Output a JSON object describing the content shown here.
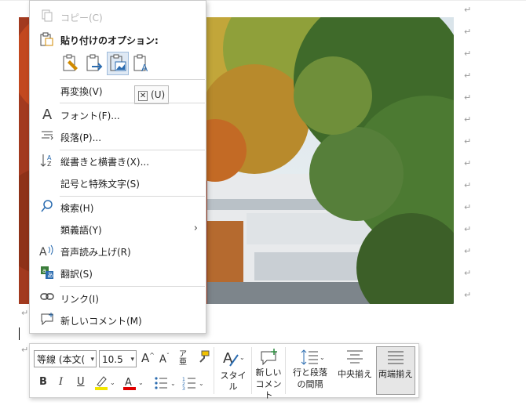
{
  "context_menu": {
    "copy": "コピー(C)",
    "paste_header": "貼り付けのオプション:",
    "paste_options": [
      {
        "icon": "paste-keep-source-icon"
      },
      {
        "icon": "paste-merge-format-icon"
      },
      {
        "icon": "paste-picture-icon"
      },
      {
        "icon": "paste-text-only-icon"
      }
    ],
    "tooltip": "(U)",
    "items": [
      {
        "label": "再変換(V)",
        "icon": ""
      },
      {
        "label": "フォント(F)...",
        "icon": "font-icon"
      },
      {
        "label": "段落(P)...",
        "icon": "paragraph-icon"
      },
      {
        "label": "縦書きと横書き(X)...",
        "icon": "text-direction-icon"
      },
      {
        "label": "記号と特殊文字(S)",
        "icon": ""
      },
      {
        "label": "検索(H)",
        "icon": "search-icon"
      },
      {
        "label": "類義語(Y)",
        "icon": ""
      },
      {
        "label": "音声読み上げ(R)",
        "icon": "read-aloud-icon"
      },
      {
        "label": "翻訳(S)",
        "icon": "translate-icon"
      },
      {
        "label": "リンク(I)",
        "icon": "link-icon"
      },
      {
        "label": "新しいコメント(M)",
        "icon": "new-comment-icon"
      }
    ]
  },
  "mini_toolbar": {
    "font_name": "等線 (本文(",
    "font_size": "10.5",
    "bold": "B",
    "italic": "I",
    "underline": "U",
    "style_label": "スタイル",
    "new_comment_label_1": "新しい",
    "new_comment_label_2": "コメント",
    "line_spacing_label_1": "行と段落",
    "line_spacing_label_2": "の間隔",
    "center_label": "中央揃え",
    "justify_label": "両端揃え",
    "highlight_color": "#f2e600",
    "font_color": "#e00000"
  }
}
